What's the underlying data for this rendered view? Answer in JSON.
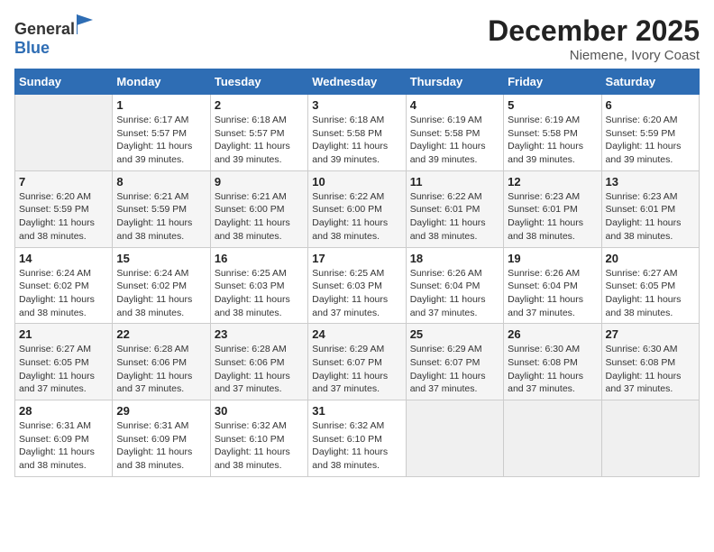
{
  "header": {
    "logo_line1": "General",
    "logo_line2": "Blue",
    "month_title": "December 2025",
    "location": "Niemene, Ivory Coast"
  },
  "weekdays": [
    "Sunday",
    "Monday",
    "Tuesday",
    "Wednesday",
    "Thursday",
    "Friday",
    "Saturday"
  ],
  "weeks": [
    [
      null,
      {
        "date": "1",
        "sunrise": "6:17 AM",
        "sunset": "5:57 PM",
        "daylight": "11 hours and 39 minutes."
      },
      {
        "date": "2",
        "sunrise": "6:18 AM",
        "sunset": "5:57 PM",
        "daylight": "11 hours and 39 minutes."
      },
      {
        "date": "3",
        "sunrise": "6:18 AM",
        "sunset": "5:58 PM",
        "daylight": "11 hours and 39 minutes."
      },
      {
        "date": "4",
        "sunrise": "6:19 AM",
        "sunset": "5:58 PM",
        "daylight": "11 hours and 39 minutes."
      },
      {
        "date": "5",
        "sunrise": "6:19 AM",
        "sunset": "5:58 PM",
        "daylight": "11 hours and 39 minutes."
      },
      {
        "date": "6",
        "sunrise": "6:20 AM",
        "sunset": "5:59 PM",
        "daylight": "11 hours and 39 minutes."
      }
    ],
    [
      {
        "date": "7",
        "sunrise": "6:20 AM",
        "sunset": "5:59 PM",
        "daylight": "11 hours and 38 minutes."
      },
      {
        "date": "8",
        "sunrise": "6:21 AM",
        "sunset": "5:59 PM",
        "daylight": "11 hours and 38 minutes."
      },
      {
        "date": "9",
        "sunrise": "6:21 AM",
        "sunset": "6:00 PM",
        "daylight": "11 hours and 38 minutes."
      },
      {
        "date": "10",
        "sunrise": "6:22 AM",
        "sunset": "6:00 PM",
        "daylight": "11 hours and 38 minutes."
      },
      {
        "date": "11",
        "sunrise": "6:22 AM",
        "sunset": "6:01 PM",
        "daylight": "11 hours and 38 minutes."
      },
      {
        "date": "12",
        "sunrise": "6:23 AM",
        "sunset": "6:01 PM",
        "daylight": "11 hours and 38 minutes."
      },
      {
        "date": "13",
        "sunrise": "6:23 AM",
        "sunset": "6:01 PM",
        "daylight": "11 hours and 38 minutes."
      }
    ],
    [
      {
        "date": "14",
        "sunrise": "6:24 AM",
        "sunset": "6:02 PM",
        "daylight": "11 hours and 38 minutes."
      },
      {
        "date": "15",
        "sunrise": "6:24 AM",
        "sunset": "6:02 PM",
        "daylight": "11 hours and 38 minutes."
      },
      {
        "date": "16",
        "sunrise": "6:25 AM",
        "sunset": "6:03 PM",
        "daylight": "11 hours and 38 minutes."
      },
      {
        "date": "17",
        "sunrise": "6:25 AM",
        "sunset": "6:03 PM",
        "daylight": "11 hours and 37 minutes."
      },
      {
        "date": "18",
        "sunrise": "6:26 AM",
        "sunset": "6:04 PM",
        "daylight": "11 hours and 37 minutes."
      },
      {
        "date": "19",
        "sunrise": "6:26 AM",
        "sunset": "6:04 PM",
        "daylight": "11 hours and 37 minutes."
      },
      {
        "date": "20",
        "sunrise": "6:27 AM",
        "sunset": "6:05 PM",
        "daylight": "11 hours and 38 minutes."
      }
    ],
    [
      {
        "date": "21",
        "sunrise": "6:27 AM",
        "sunset": "6:05 PM",
        "daylight": "11 hours and 37 minutes."
      },
      {
        "date": "22",
        "sunrise": "6:28 AM",
        "sunset": "6:06 PM",
        "daylight": "11 hours and 37 minutes."
      },
      {
        "date": "23",
        "sunrise": "6:28 AM",
        "sunset": "6:06 PM",
        "daylight": "11 hours and 37 minutes."
      },
      {
        "date": "24",
        "sunrise": "6:29 AM",
        "sunset": "6:07 PM",
        "daylight": "11 hours and 37 minutes."
      },
      {
        "date": "25",
        "sunrise": "6:29 AM",
        "sunset": "6:07 PM",
        "daylight": "11 hours and 37 minutes."
      },
      {
        "date": "26",
        "sunrise": "6:30 AM",
        "sunset": "6:08 PM",
        "daylight": "11 hours and 37 minutes."
      },
      {
        "date": "27",
        "sunrise": "6:30 AM",
        "sunset": "6:08 PM",
        "daylight": "11 hours and 37 minutes."
      }
    ],
    [
      {
        "date": "28",
        "sunrise": "6:31 AM",
        "sunset": "6:09 PM",
        "daylight": "11 hours and 38 minutes."
      },
      {
        "date": "29",
        "sunrise": "6:31 AM",
        "sunset": "6:09 PM",
        "daylight": "11 hours and 38 minutes."
      },
      {
        "date": "30",
        "sunrise": "6:32 AM",
        "sunset": "6:10 PM",
        "daylight": "11 hours and 38 minutes."
      },
      {
        "date": "31",
        "sunrise": "6:32 AM",
        "sunset": "6:10 PM",
        "daylight": "11 hours and 38 minutes."
      },
      null,
      null,
      null
    ]
  ],
  "labels": {
    "sunrise_prefix": "Sunrise: ",
    "sunset_prefix": "Sunset: ",
    "daylight_prefix": "Daylight: "
  }
}
